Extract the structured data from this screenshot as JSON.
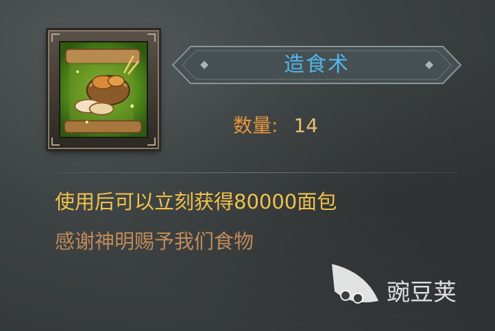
{
  "item": {
    "icon": "bread-basket-scroll-icon",
    "title": "造食术",
    "quantity_label": "数量:",
    "quantity_value": "14"
  },
  "description": {
    "line1": "使用后可以立刻获得80000面包",
    "line2": "感谢神明赐予我们食物"
  },
  "watermark": {
    "logo": "wandoujia-pea-logo",
    "text": "豌豆荚"
  },
  "colors": {
    "title": "#4fb6ee",
    "quantity_label": "#e8973a",
    "quantity_value": "#e8c070",
    "description_main": "#f0c24a",
    "description_sub": "#c08a5a"
  }
}
